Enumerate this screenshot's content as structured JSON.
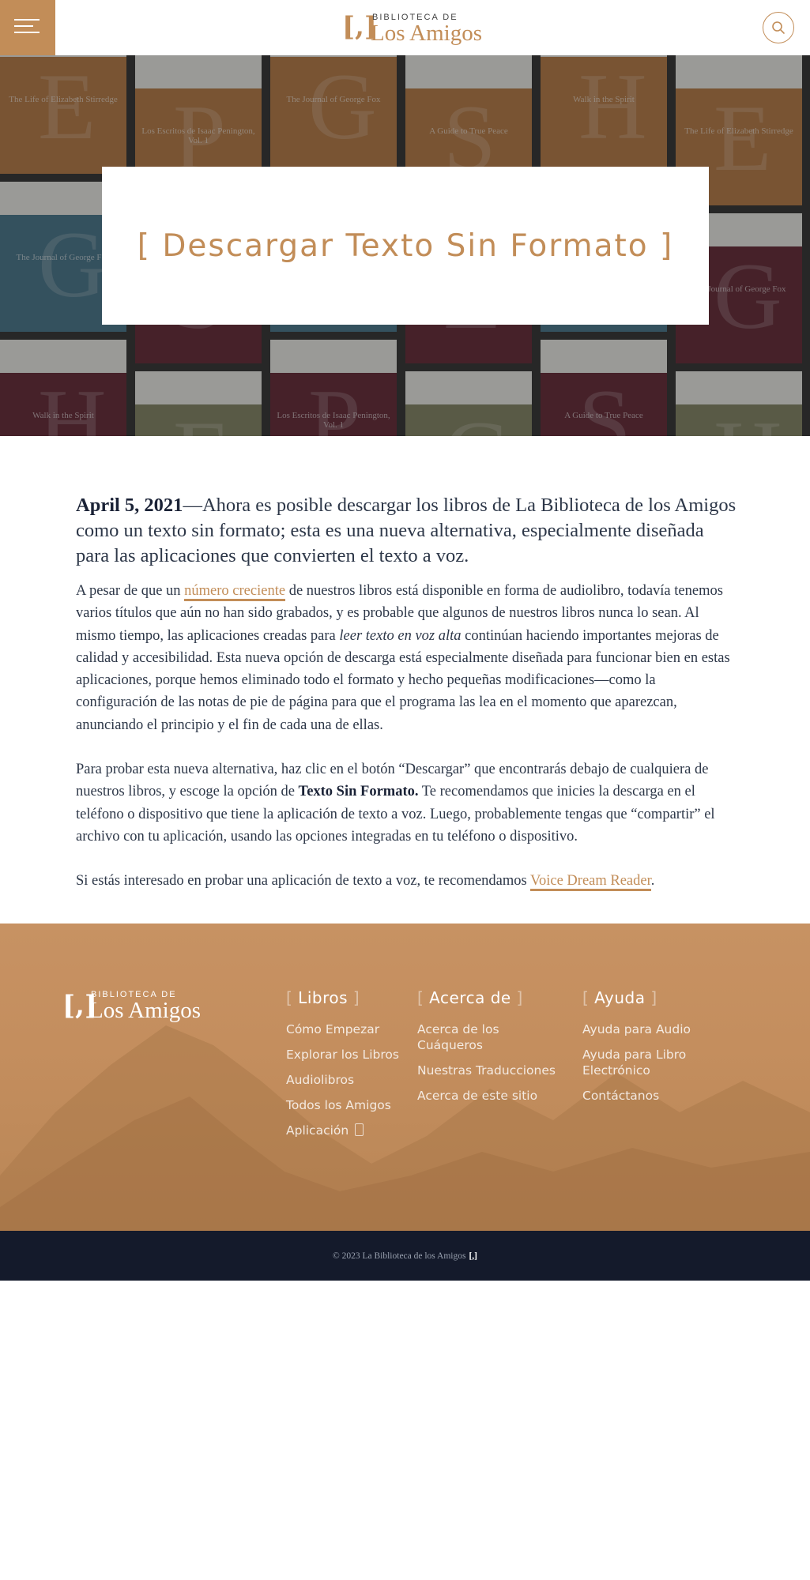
{
  "header": {
    "logo_small": "BIBLIOTECA DE",
    "logo_big": "Los Amigos",
    "logo_mark": "[,]",
    "menu_icon": "hamburger-icon",
    "search_icon": "search-icon",
    "accent_color": "#c28d58"
  },
  "hero": {
    "title": "[ Descargar Texto Sin Formato ]",
    "background_books": [
      {
        "title": "The Life of Elizabeth Stirredge",
        "letter": "E"
      },
      {
        "title": "The Journal of George Fox",
        "letter": "G"
      },
      {
        "title": "Walk in the Spirit",
        "letter": "H"
      },
      {
        "title": "Los Escritos de Isaac Penington, Vol. 1",
        "letter": "P"
      },
      {
        "title": "A Guide to True Peace",
        "letter": "S"
      }
    ]
  },
  "article": {
    "date": "April 5, 2021",
    "lead": "—Ahora es posible descargar los libros de La Biblioteca de los Amigos como un texto sin formato; esta es una nueva alternativa, especialmente diseñada para las aplicaciones que convierten el texto a voz.",
    "p1_a": "A pesar de que un ",
    "p1_link": "número creciente",
    "p1_b": " de nuestros libros está disponible en forma de audiolibro, todavía tenemos varios títulos que aún no han sido grabados, y es probable que algunos de nuestros libros nunca lo sean. Al mismo tiempo, las aplicaciones creadas para ",
    "p1_em": "leer texto en voz alta",
    "p1_c": " continúan haciendo importantes mejoras de calidad y accesibilidad. Esta nueva opción de descarga está especialmente diseñada para funcionar bien en estas aplicaciones, porque hemos eliminado todo el formato y hecho pequeñas modificaciones—como la configuración de las notas de pie de página para que el programa las lea en el momento que aparezcan, anunciando el principio y el fin de cada una de ellas.",
    "p2_a": "Para probar esta nueva alternativa, haz clic en el botón “Descargar” que encontrarás debajo de cualquiera de nuestros libros, y escoge la opción de ",
    "p2_strong": "Texto Sin Formato.",
    "p2_b": " Te recomendamos que inicies la descarga en el teléfono o dispositivo que tiene la aplicación de texto a voz. Luego, probablemente tengas que “compartir” el archivo con tu aplicación, usando las opciones integradas en tu teléfono o dispositivo.",
    "p3_a": "Si estás interesado en probar una aplicación de texto a voz, te recomendamos ",
    "p3_link": "Voice Dream Reader",
    "p3_b": "."
  },
  "footer": {
    "logo_small": "BIBLIOTECA DE",
    "logo_big": "Los Amigos",
    "logo_mark": "[,]",
    "col1": {
      "heading": "Libros",
      "items": [
        "Cómo Empezar",
        "Explorar los Libros",
        "Audiolibros",
        "Todos los Amigos",
        "Aplicación"
      ]
    },
    "col2": {
      "heading": "Acerca de",
      "items": [
        "Acerca de los Cuáqueros",
        "Nuestras Traducciones",
        "Acerca de este sitio"
      ]
    },
    "col3": {
      "heading": "Ayuda",
      "items": [
        "Ayuda para Audio",
        "Ayuda para Libro Electrónico",
        "Contáctanos"
      ]
    },
    "copyright": "© 2023 La Biblioteca de los Amigos",
    "copyright_mark": "[,]"
  }
}
